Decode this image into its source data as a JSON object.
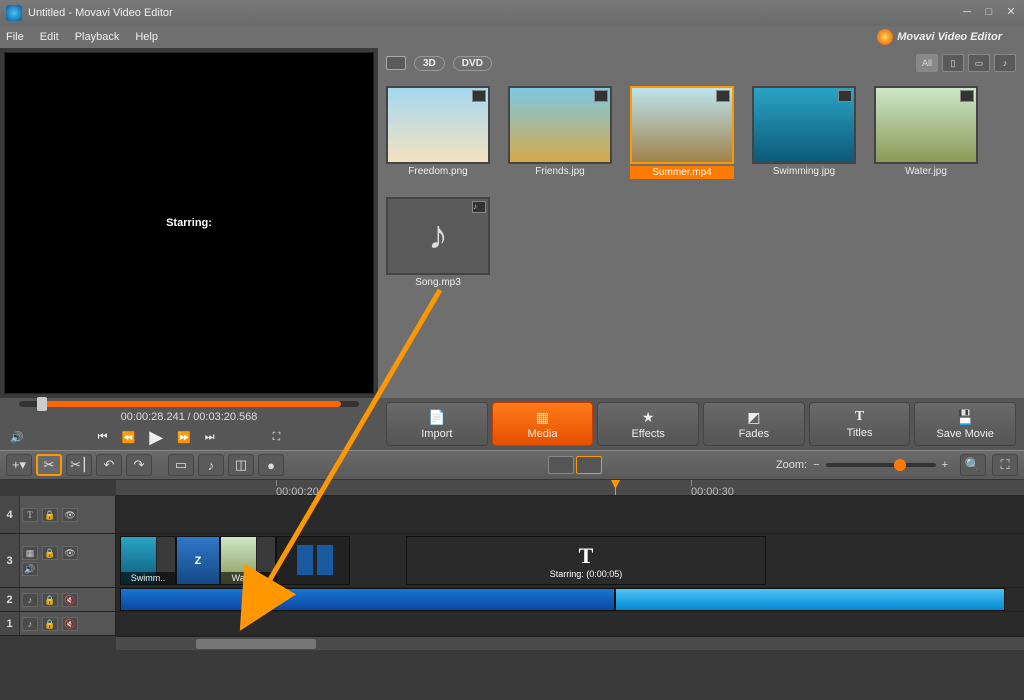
{
  "window": {
    "title": "Untitled - Movavi Video Editor",
    "brand": "Movavi Video Editor"
  },
  "menu": [
    "File",
    "Edit",
    "Playback",
    "Help"
  ],
  "preview": {
    "text": "Starring:"
  },
  "playback": {
    "current": "00:00:28.241",
    "total": "00:03:20.568"
  },
  "media_toolbar": {
    "tab3d": "3D",
    "tabdvd": "DVD",
    "filter_all": "All"
  },
  "media_items": [
    {
      "name": "Freedom.png",
      "kind": "image"
    },
    {
      "name": "Friends.jpg",
      "kind": "image"
    },
    {
      "name": "Summer.mp4",
      "kind": "video",
      "selected": true
    },
    {
      "name": "Swimming.jpg",
      "kind": "image"
    },
    {
      "name": "Water.jpg",
      "kind": "image"
    },
    {
      "name": "Song.mp3",
      "kind": "audio"
    }
  ],
  "tabs": [
    {
      "label": "Import",
      "icon": "⇥"
    },
    {
      "label": "Media",
      "icon": "▦",
      "active": true
    },
    {
      "label": "Effects",
      "icon": "★"
    },
    {
      "label": "Fades",
      "icon": "◩"
    },
    {
      "label": "Titles",
      "icon": "T"
    },
    {
      "label": "Save Movie",
      "icon": "⭳"
    }
  ],
  "zoom": {
    "label": "Zoom:"
  },
  "ruler": {
    "t1": "00:00:20",
    "t2": "00:00:30"
  },
  "tracks": {
    "title_clip": {
      "big": "T",
      "caption": "Starring: (0:00:05)"
    },
    "clip1": "Swimm..",
    "clip2": "Z",
    "clip3": "Water.j.."
  },
  "track_numbers": [
    "4",
    "3",
    "2",
    "1"
  ]
}
